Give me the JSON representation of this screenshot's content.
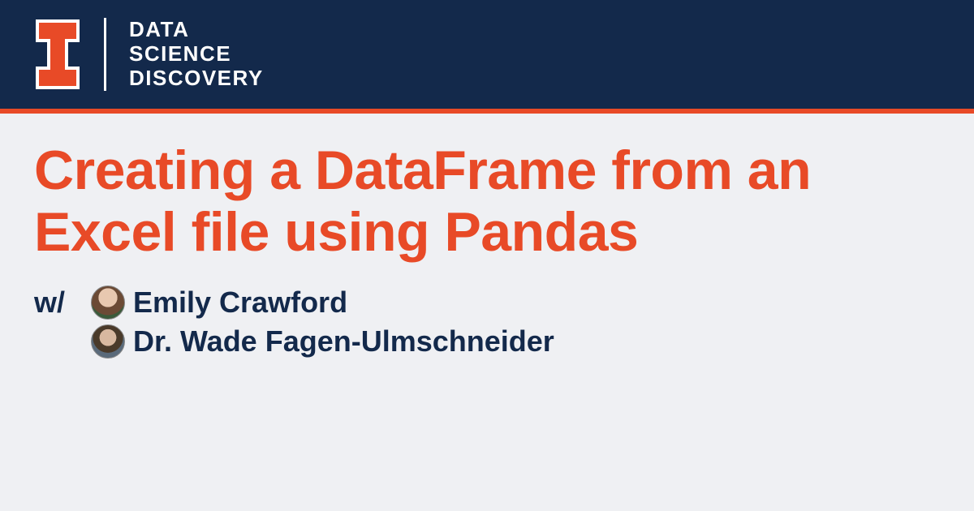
{
  "header": {
    "brand_line1": "DATA",
    "brand_line2": "SCIENCE",
    "brand_line3": "DISCOVERY"
  },
  "content": {
    "title": "Creating a DataFrame from an Excel file using Pandas",
    "with_label": "w/",
    "authors": [
      {
        "name": "Emily Crawford"
      },
      {
        "name": "Dr. Wade Fagen-Ulmschneider"
      }
    ]
  },
  "colors": {
    "navy": "#13294b",
    "orange": "#e84a27",
    "background": "#eff0f3"
  }
}
